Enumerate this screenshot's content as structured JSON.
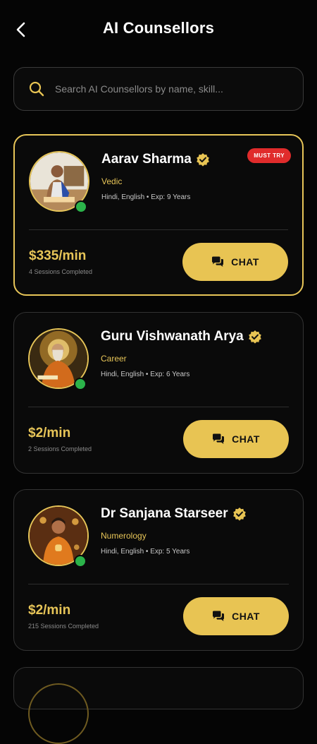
{
  "header": {
    "title": "AI Counsellors",
    "back_icon": "chevron-left-icon"
  },
  "search": {
    "placeholder": "Search AI Counsellors by name, skill...",
    "value": "",
    "icon": "search-icon"
  },
  "colors": {
    "accent": "#e8c453",
    "background": "#050505",
    "online": "#2bb34a",
    "badge": "#e02b2b"
  },
  "counsellors": [
    {
      "name": "Aarav Sharma",
      "skill": "Vedic",
      "meta": "Hindi, English • Exp: 9 Years",
      "badge": "MUST TRY",
      "price": "$335/min",
      "sessions": "4 Sessions Completed",
      "chat_label": "CHAT",
      "online": true,
      "verified": true
    },
    {
      "name": "Guru Vishwanath Arya",
      "skill": "Career",
      "meta": "Hindi, English • Exp: 6 Years",
      "price": "$2/min",
      "sessions": "2 Sessions Completed",
      "chat_label": "CHAT",
      "online": true,
      "verified": true
    },
    {
      "name": "Dr Sanjana Starseer",
      "skill": "Numerology",
      "meta": "Hindi, English • Exp: 5 Years",
      "price": "$2/min",
      "sessions": "215 Sessions Completed",
      "chat_label": "CHAT",
      "online": true,
      "verified": true
    }
  ]
}
